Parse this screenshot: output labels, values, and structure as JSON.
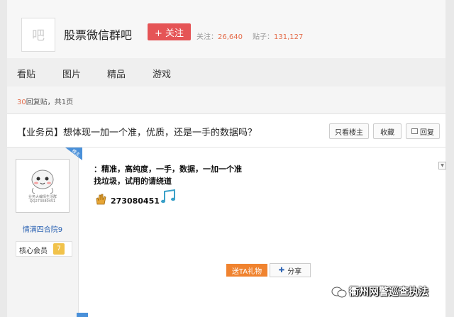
{
  "header": {
    "logo_text": "吧",
    "forum_name": "股票微信群吧",
    "follow_label": "+ 关注",
    "follow_count_label": "关注：",
    "follow_count": "26,640",
    "posts_count_label": "贴子：",
    "posts_count": "131,127"
  },
  "nav": {
    "items": [
      {
        "label": "看贴"
      },
      {
        "label": "图片"
      },
      {
        "label": "精品"
      },
      {
        "label": "游戏"
      }
    ]
  },
  "thread": {
    "reply_count": "30",
    "reply_suffix": "回复贴，共1页",
    "title": "【业务员】想体现一加一个准，优质，还是一手的数据吗？",
    "buttons": {
      "only_op": "只看楼主",
      "favorite": "收藏",
      "reply": "回复"
    }
  },
  "post": {
    "corner_tag": "楼主",
    "avatar_caption_1": "业务大编情生活群",
    "avatar_caption_2": "QQ273080451",
    "username": "情满四合院9",
    "badge_label": "核心会员",
    "badge_level": "7",
    "content_line1": "：精准，高纯度，一手，数据，一加一个准",
    "content_line2": "找垃圾，试用的请绕道",
    "qq_number": "273080451",
    "gift_label": "送TA礼物",
    "share_label": "分享"
  },
  "watermark": {
    "text": "衢州网警巡查执法"
  },
  "colors": {
    "accent_red": "#e55456",
    "link_blue": "#2d64b3",
    "orange": "#f0832f"
  }
}
